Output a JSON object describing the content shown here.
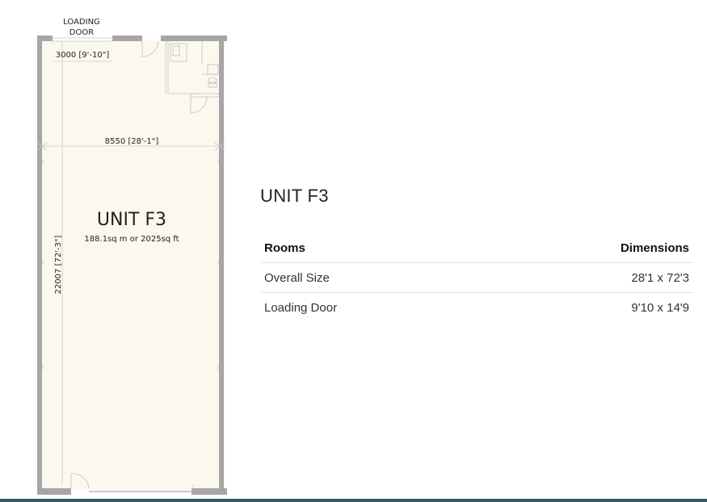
{
  "floorplan": {
    "loading_door_label": [
      "LOADING",
      "DOOR"
    ],
    "door_width_dim": "3000 [9'-10\"]",
    "unit_width_dim": "8550 [28'-1\"]",
    "unit_length_dim": "22007 [72'-3\"]",
    "unit_name": "UNIT F3",
    "unit_area": "188.1sq m or 2025sq ft"
  },
  "details": {
    "title": "UNIT F3",
    "columns": {
      "rooms": "Rooms",
      "dimensions": "Dimensions"
    },
    "rows": [
      {
        "room": "Overall Size",
        "dimensions": "28'1 x 72'3"
      },
      {
        "room": "Loading Door",
        "dimensions": "9'10 x 14'9"
      }
    ]
  },
  "colors": {
    "floor_fill": "#fdf8ee",
    "wall": "#a6a6a6",
    "footer_bar": "#2e5a63"
  }
}
